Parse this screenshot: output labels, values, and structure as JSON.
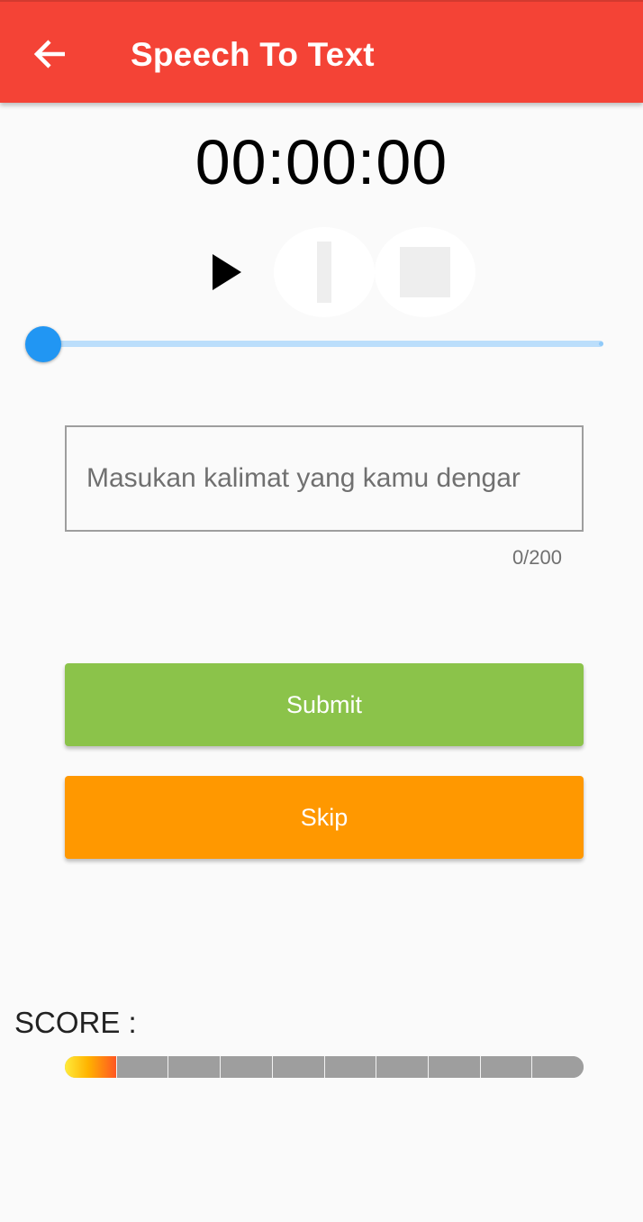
{
  "appbar": {
    "title": "Speech To Text",
    "back_icon": "arrow-left-icon",
    "color": "#f44336"
  },
  "player": {
    "timer": "00:00:00",
    "play_icon": "play-icon",
    "pause_icon": "pause-icon",
    "stop_icon": "stop-icon",
    "progress": 0
  },
  "answer": {
    "placeholder": "Masukan kalimat yang kamu dengar",
    "value": "",
    "counter": "0/200"
  },
  "actions": {
    "submit_label": "Submit",
    "submit_color": "#8bc34a",
    "skip_label": "Skip",
    "skip_color": "#ff9800"
  },
  "score": {
    "label": "SCORE :",
    "segments_total": 10,
    "segments_filled": 1
  }
}
